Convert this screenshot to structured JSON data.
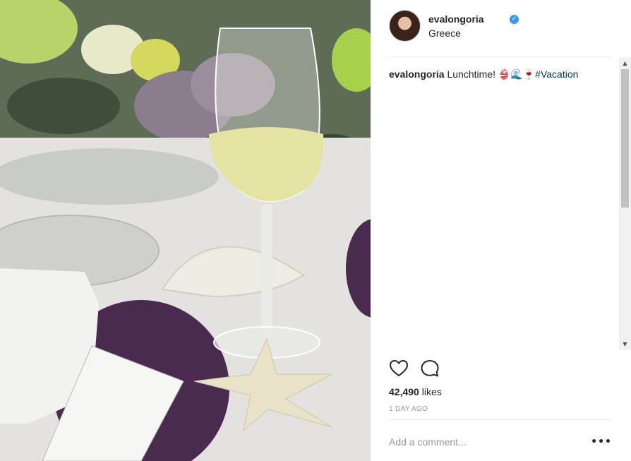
{
  "photo": {
    "alt": "Glass of white wine on a set table with starfish and shell"
  },
  "post": {
    "username": "evalongoria",
    "verified_glyph": "✓",
    "location": "Greece",
    "caption": {
      "username": "evalongoria",
      "text": " Lunchtime! 👙🌊🍷",
      "hashtag": "#Vacation"
    },
    "likes_count": "42,490",
    "likes_word": " likes",
    "timestamp": "1 DAY AGO",
    "comment_placeholder": "Add a comment...",
    "more_glyph": "•••"
  },
  "icons": {
    "like": "heart-outline-icon",
    "comment": "speech-bubble-icon",
    "verified": "verified-badge-icon",
    "more": "more-options-icon"
  },
  "colors": {
    "link": "#003569",
    "verified": "#3897f0",
    "muted": "#999999",
    "text": "#262626"
  },
  "scrollbar": {
    "up_glyph": "▲",
    "down_glyph": "▼"
  }
}
